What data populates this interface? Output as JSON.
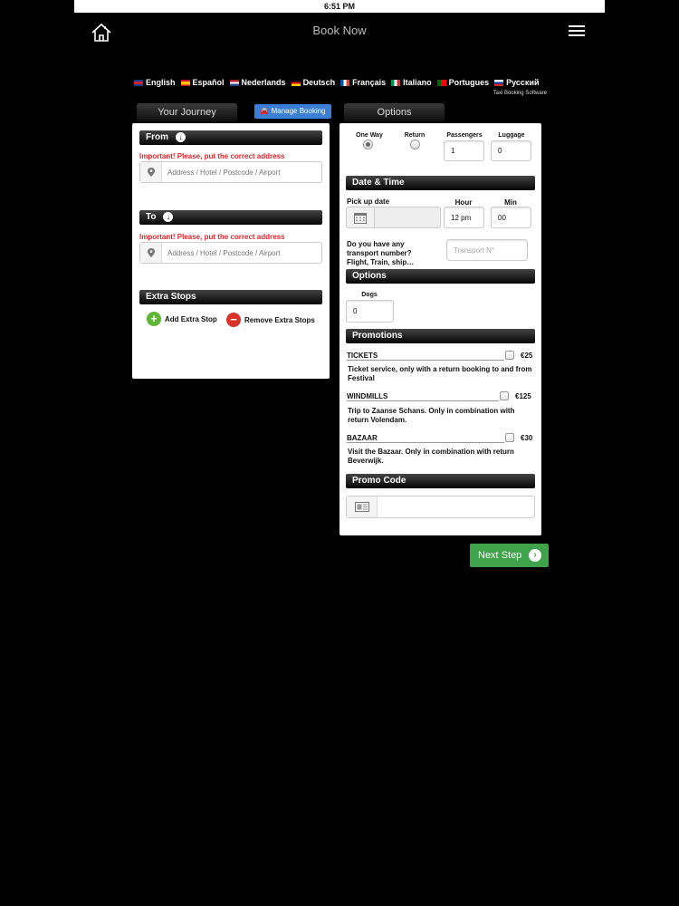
{
  "status": {
    "time": "6:51 PM"
  },
  "nav": {
    "title": "Book Now",
    "home_icon": "home-icon",
    "menu_icon": "hamburger-menu-icon"
  },
  "languages": [
    {
      "label": "English",
      "colors": [
        "#1a3c8c",
        "#d21f2c"
      ]
    },
    {
      "label": "Español",
      "colors": [
        "#c8102e",
        "#ffc400"
      ]
    },
    {
      "label": "Nederlands",
      "colors": [
        "#ae1c28",
        "#21468b"
      ]
    },
    {
      "label": "Deutsch",
      "colors": [
        "#000000",
        "#dd0000"
      ]
    },
    {
      "label": "Français",
      "colors": [
        "#0055a4",
        "#ef4135"
      ]
    },
    {
      "label": "Italiano",
      "colors": [
        "#009246",
        "#ce2b37"
      ]
    },
    {
      "label": "Portugues",
      "colors": [
        "#006600",
        "#ff0000"
      ]
    },
    {
      "label": "Русский",
      "colors": [
        "#0039a6",
        "#d52b1e"
      ]
    }
  ],
  "tagline": "Taxi Booking Software",
  "tabs": {
    "journey": "Your Journey",
    "manage": "Manage Booking",
    "options": "Options"
  },
  "journey": {
    "from_label": "From",
    "to_label": "To",
    "warning": "Important! Please, put the correct address",
    "address_placeholder": "Address / Hotel / Postcode / Airport",
    "extra_stops_label": "Extra Stops",
    "add_stop": "Add Extra Stop",
    "remove_stop": "Remove Extra Stops"
  },
  "options": {
    "one_way": "One Way",
    "return": "Return",
    "passengers_label": "Passengers",
    "passengers_value": "1",
    "luggage_label": "Luggage",
    "luggage_value": "0",
    "datetime_label": "Date & Time",
    "pickup_label": "Pick up date",
    "hour_label": "Hour",
    "hour_value": "12 pm",
    "min_label": "Min",
    "min_value": "00",
    "transport_question": "Do you have any transport number? Flight, Train, ship…",
    "transport_placeholder": "Transport N°",
    "options_label": "Options",
    "dogs_label": "Dogs",
    "dogs_value": "0",
    "promotions_label": "Promotions",
    "promotions": [
      {
        "title": "TICKETS",
        "price": "€25",
        "desc": "Ticket service, only with a return booking to and from Festival"
      },
      {
        "title": "WINDMILLS",
        "price": "€125",
        "desc": "Trip to Zaanse Schans. Only in combination with return Volendam."
      },
      {
        "title": "BAZAAR",
        "price": "€30",
        "desc": "Visit the Bazaar. Only in combination with return Beverwijk."
      }
    ],
    "promo_code_label": "Promo Code"
  },
  "next_step": "Next Step",
  "colors": {
    "accent_blue": "#3a7fd5",
    "next_green": "#3ea34a",
    "warning_red": "#e3252c"
  }
}
